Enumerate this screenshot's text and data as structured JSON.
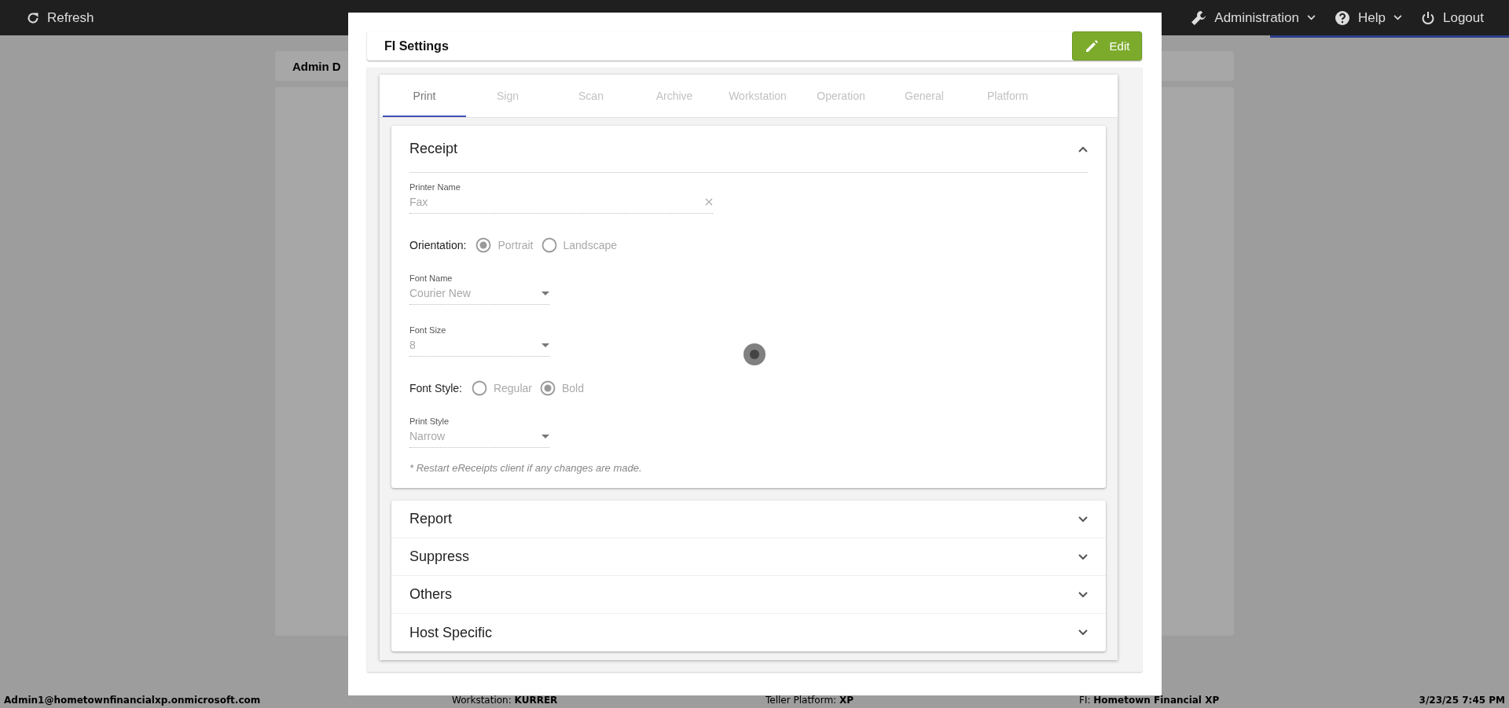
{
  "top_bar": {
    "refresh": "Refresh",
    "menus": [
      {
        "label": "Administration",
        "kind": "wrench"
      },
      {
        "label": "Help",
        "kind": "help"
      }
    ],
    "logout": "Logout"
  },
  "page": {
    "card_title": "Admin D"
  },
  "status_bar": {
    "user": "Admin1@hometownfinancialxp.onmicrosoft.com",
    "fields": [
      {
        "label": "Workstation:",
        "value": "KURRER"
      },
      {
        "label": "Teller Platform:",
        "value": "XP"
      },
      {
        "label": "FI:",
        "value": "Hometown Financial XP"
      }
    ],
    "datetime": "3/23/25 7:45 PM"
  },
  "dialog": {
    "title": "FI Settings",
    "edit_button": "Edit",
    "tabs": [
      {
        "label": "Print",
        "selected": true
      },
      {
        "label": "Sign",
        "selected": false
      },
      {
        "label": "Scan",
        "selected": false
      },
      {
        "label": "Archive",
        "selected": false
      },
      {
        "label": "Workstation",
        "selected": false
      },
      {
        "label": "Operation",
        "selected": false
      },
      {
        "label": "General",
        "selected": false
      },
      {
        "label": "Platform",
        "selected": false
      }
    ],
    "sections": [
      {
        "title": "Receipt",
        "expanded": true,
        "fields": [
          {
            "kind": "text",
            "label": "Printer Name",
            "value": "Fax",
            "clearable": true
          },
          {
            "kind": "radio",
            "label": "Orientation:",
            "options": [
              {
                "label": "Portrait",
                "selected": true
              },
              {
                "label": "Landscape",
                "selected": false
              }
            ]
          },
          {
            "kind": "select",
            "label": "Font Name",
            "value": "Courier New"
          },
          {
            "kind": "select",
            "label": "Font Size",
            "value": "8"
          },
          {
            "kind": "radio",
            "label": "Font Style:",
            "options": [
              {
                "label": "Regular",
                "selected": false
              },
              {
                "label": "Bold",
                "selected": true
              }
            ]
          },
          {
            "kind": "select",
            "label": "Print Style",
            "value": "Narrow"
          }
        ],
        "note": "* Restart eReceipts client if any changes are made."
      },
      {
        "title": "Report",
        "expanded": false
      },
      {
        "title": "Suppress",
        "expanded": false
      },
      {
        "title": "Others",
        "expanded": false
      },
      {
        "title": "Host Specific",
        "expanded": false
      }
    ]
  }
}
